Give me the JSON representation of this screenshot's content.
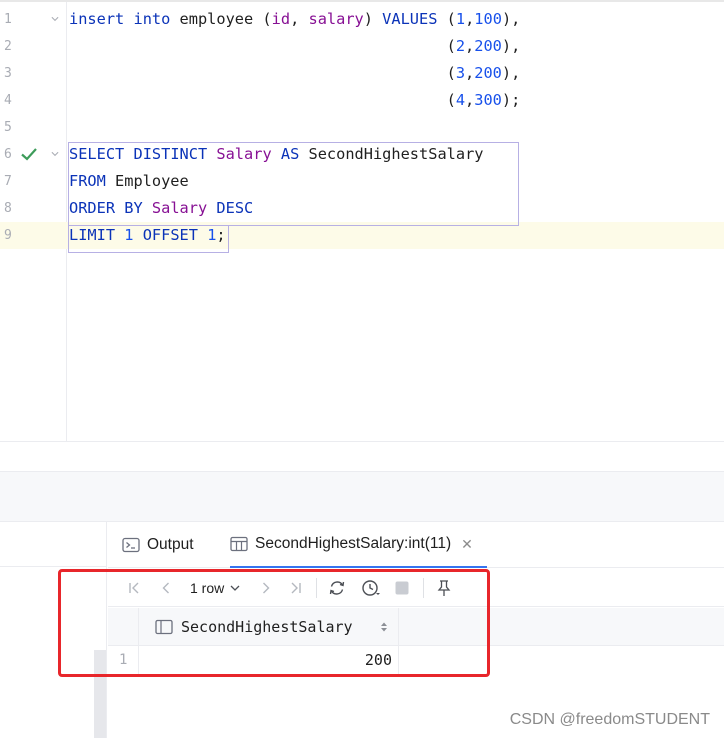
{
  "editor": {
    "lines": [
      {
        "n": "1",
        "tokens": [
          [
            "kw",
            "insert"
          ],
          [
            "",
            " "
          ],
          [
            "kw",
            "into"
          ],
          [
            "",
            " employee ("
          ],
          [
            "fn",
            "id"
          ],
          [
            "",
            ", "
          ],
          [
            "fn",
            "salary"
          ],
          [
            "",
            ") "
          ],
          [
            "kw",
            "VALUES"
          ],
          [
            "",
            " ("
          ],
          [
            "num",
            "1"
          ],
          [
            "",
            ","
          ],
          [
            "num",
            "100"
          ],
          [
            "",
            "),"
          ]
        ]
      },
      {
        "n": "2",
        "tokens": [
          [
            "",
            "                                         ("
          ],
          [
            "num",
            "2"
          ],
          [
            "",
            ","
          ],
          [
            "num",
            "200"
          ],
          [
            "",
            "),"
          ]
        ]
      },
      {
        "n": "3",
        "tokens": [
          [
            "",
            "                                         ("
          ],
          [
            "num",
            "3"
          ],
          [
            "",
            ","
          ],
          [
            "num",
            "200"
          ],
          [
            "",
            "),"
          ]
        ]
      },
      {
        "n": "4",
        "tokens": [
          [
            "",
            "                                         ("
          ],
          [
            "num",
            "4"
          ],
          [
            "",
            ","
          ],
          [
            "num",
            "300"
          ],
          [
            "",
            ");"
          ]
        ]
      },
      {
        "n": "5",
        "tokens": []
      },
      {
        "n": "6",
        "tokens": [
          [
            "kw",
            "SELECT"
          ],
          [
            "",
            " "
          ],
          [
            "kw",
            "DISTINCT"
          ],
          [
            "",
            " "
          ],
          [
            "fn",
            "Salary"
          ],
          [
            "",
            " "
          ],
          [
            "kw",
            "AS"
          ],
          [
            "",
            " SecondHighestSalary"
          ]
        ]
      },
      {
        "n": "7",
        "tokens": [
          [
            "kw",
            "FROM"
          ],
          [
            "",
            " Employee"
          ]
        ]
      },
      {
        "n": "8",
        "tokens": [
          [
            "kw",
            "ORDER"
          ],
          [
            "",
            " "
          ],
          [
            "kw",
            "BY"
          ],
          [
            "",
            " "
          ],
          [
            "fn",
            "Salary"
          ],
          [
            "",
            " "
          ],
          [
            "kw",
            "DESC"
          ]
        ]
      },
      {
        "n": "9",
        "tokens": [
          [
            "kw",
            "LIMIT"
          ],
          [
            "",
            " "
          ],
          [
            "num",
            "1"
          ],
          [
            "",
            " "
          ],
          [
            "kw",
            "OFFSET"
          ],
          [
            "",
            " "
          ],
          [
            "num",
            "1"
          ],
          [
            "",
            ";"
          ]
        ]
      }
    ]
  },
  "services": {
    "tabs": {
      "output_label": "Output",
      "result_label": "SecondHighestSalary:int(11)",
      "close_glyph": "✕"
    },
    "toolbar": {
      "rows_label": "1 row"
    },
    "grid": {
      "column_header": "SecondHighestSalary",
      "rows": [
        {
          "n": "1",
          "value": "200"
        }
      ]
    }
  },
  "colors": {
    "highlight": "#e8262b",
    "keyword": "#0b33b8",
    "identifier": "#871094",
    "number": "#1750eb",
    "accent": "#3574f0"
  },
  "watermark": "CSDN @freedomSTUDENT"
}
